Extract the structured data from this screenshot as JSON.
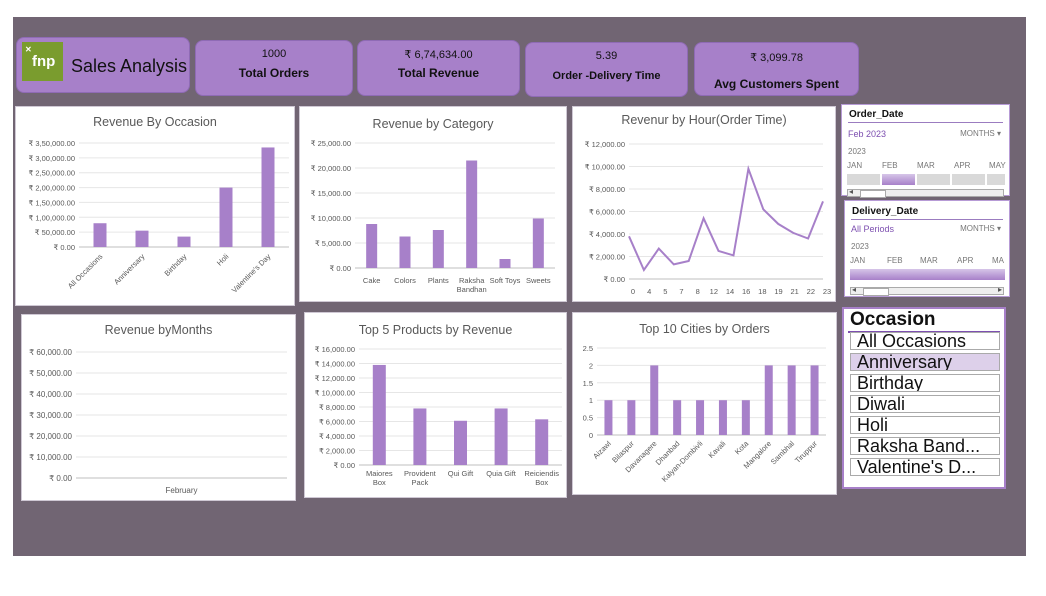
{
  "header": {
    "logo_text": "fnp",
    "logo_small": "✕",
    "title": "Sales Analysis"
  },
  "kpis": [
    {
      "value": "1000",
      "label": "Total Orders"
    },
    {
      "value": "₹ 6,74,634.00",
      "label": "Total Revenue"
    },
    {
      "value": "5.39",
      "label": "Order -Delivery Time"
    },
    {
      "value": "₹ 3,099.78",
      "label": "Avg Customers Spent"
    }
  ],
  "colors": {
    "accent": "#a780c9",
    "background": "#716573",
    "bar": "#a780c9"
  },
  "chart_data": [
    {
      "type": "bar",
      "title": "Revenue By Occasion",
      "categories": [
        "All Occasions",
        "Anniversary",
        "Birthday",
        "Holi",
        "Valentine's Day"
      ],
      "values": [
        80000,
        55000,
        35000,
        200000,
        335000
      ],
      "ylim": [
        0,
        350000
      ],
      "yticks": [
        "₹ 0.00",
        "₹ 50,000.00",
        "₹ 1,00,000.00",
        "₹ 1,50,000.00",
        "₹ 2,00,000.00",
        "₹ 2,50,000.00",
        "₹ 3,00,000.00",
        "₹ 3,50,000.00"
      ]
    },
    {
      "type": "bar",
      "title": "Revenue by Category",
      "categories": [
        "Cake",
        "Colors",
        "Plants",
        "Raksha Bandhan",
        "Soft Toys",
        "Sweets"
      ],
      "values": [
        8800,
        6300,
        7600,
        21500,
        1800,
        9900
      ],
      "ylim": [
        0,
        25000
      ],
      "yticks": [
        "₹ 0.00",
        "₹ 5,000.00",
        "₹ 10,000.00",
        "₹ 15,000.00",
        "₹ 20,000.00",
        "₹ 25,000.00"
      ]
    },
    {
      "type": "line",
      "title": "Revenur by Hour(Order Time)",
      "x": [
        "0",
        "4",
        "5",
        "7",
        "8",
        "12",
        "14",
        "16",
        "18",
        "19",
        "21",
        "22",
        "23"
      ],
      "values": [
        3800,
        800,
        2700,
        1300,
        1600,
        5400,
        2500,
        2100,
        9800,
        6200,
        4900,
        4100,
        3600,
        6900
      ],
      "xlabels": [
        "0",
        "4",
        "5",
        "7",
        "8",
        "12",
        "14",
        "16",
        "18",
        "19",
        "21",
        "22",
        "23"
      ],
      "ylim": [
        0,
        12000
      ],
      "yticks": [
        "₹ 0.00",
        "₹ 2,000.00",
        "₹ 4,000.00",
        "₹ 6,000.00",
        "₹ 8,000.00",
        "₹ 10,000.00",
        "₹ 12,000.00"
      ]
    },
    {
      "type": "bar",
      "title": "Revenue byMonths",
      "categories": [
        "February"
      ],
      "values": [
        0
      ],
      "ylim": [
        0,
        60000
      ],
      "yticks": [
        "₹ 0.00",
        "₹ 10,000.00",
        "₹ 20,000.00",
        "₹ 30,000.00",
        "₹ 40,000.00",
        "₹ 50,000.00",
        "₹ 60,000.00"
      ]
    },
    {
      "type": "bar",
      "title": "Top 5 Products by Revenue",
      "categories": [
        "Maiores Box",
        "Provident Pack",
        "Qui Gift",
        "Quia Gift",
        "Reiciendis Box"
      ],
      "values": [
        13800,
        7800,
        6100,
        7800,
        6300
      ],
      "ylim": [
        0,
        16000
      ],
      "yticks": [
        "₹ 0.00",
        "₹ 2,000.00",
        "₹ 4,000.00",
        "₹ 6,000.00",
        "₹ 8,000.00",
        "₹ 10,000.00",
        "₹ 12,000.00",
        "₹ 14,000.00",
        "₹ 16,000.00"
      ]
    },
    {
      "type": "bar",
      "title": "Top 10 Cities by Orders",
      "categories": [
        "Aizawl",
        "Bilaspur",
        "Davanagere",
        "Dhanbad",
        "Kalyan-Dombivli",
        "Kavali",
        "Kota",
        "Mangalore",
        "Sambhal",
        "Tiruppur"
      ],
      "values": [
        1,
        1,
        2,
        1,
        1,
        1,
        1,
        2,
        2,
        2
      ],
      "ylim": [
        0,
        2.5
      ],
      "yticks": [
        "0",
        "0.5",
        "1",
        "1.5",
        "2",
        "2.5"
      ]
    }
  ],
  "slicers": {
    "order_date": {
      "title": "Order_Date",
      "period": "Feb 2023",
      "level": "MONTHS",
      "year": "2023",
      "months": [
        "JAN",
        "FEB",
        "MAR",
        "APR",
        "MAY"
      ]
    },
    "delivery_date": {
      "title": "Delivery_Date",
      "period": "All Periods",
      "level": "MONTHS",
      "year": "2023",
      "months": [
        "JAN",
        "FEB",
        "MAR",
        "APR",
        "MA"
      ]
    },
    "occasion": {
      "title": "Occasion",
      "items": [
        "All Occasions",
        "Anniversary",
        "Birthday",
        "Diwali",
        "Holi",
        "Raksha Band...",
        "Valentine's D..."
      ],
      "selected": "Anniversary"
    }
  }
}
